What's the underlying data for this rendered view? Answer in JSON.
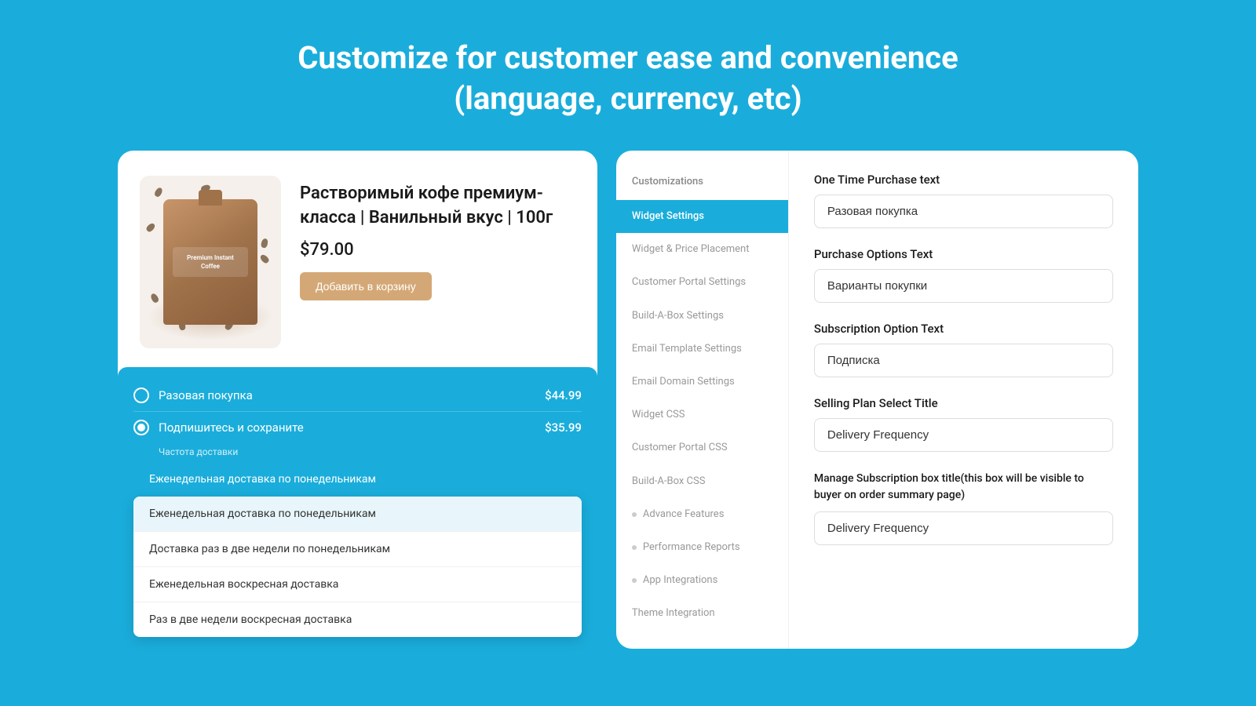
{
  "headline": {
    "line1": "Customize for customer ease and convenience",
    "line2": "(language, currency, etc)"
  },
  "left_card": {
    "product": {
      "title": "Растворимый кофе премиум-класса | Ванильный вкус | 100г",
      "price": "$79.00",
      "add_to_cart": "Добавить в корзину",
      "image_label": "Premium\nInstant\nCoffee"
    },
    "widget": {
      "option_one_time": "Разовая покупка",
      "option_one_time_price": "$44.99",
      "option_subscribe": "Подпишитесь и сохраните",
      "option_subscribe_price": "$35.99",
      "frequency_label": "Частота доставки",
      "dropdown_selected": "Еженедельная доставка по понедельникам",
      "dropdown_items": [
        "Еженедельная доставка по понедельникам",
        "Доставка раз в две недели по понедельникам",
        "Еженедельная воскресная доставка",
        "Раз в две недели воскресная доставка"
      ]
    }
  },
  "right_card": {
    "sidebar_label": "Customizations",
    "sidebar_items": [
      {
        "label": "Widget Settings",
        "active": true
      },
      {
        "label": "Widget & Price Placement",
        "active": false
      },
      {
        "label": "Customer Portal Settings",
        "active": false
      },
      {
        "label": "Build-A-Box Settings",
        "active": false
      },
      {
        "label": "Email Template Settings",
        "active": false
      },
      {
        "label": "Email Domain Settings",
        "active": false
      },
      {
        "label": "Widget CSS",
        "active": false
      },
      {
        "label": "Customer Portal CSS",
        "active": false
      },
      {
        "label": "Build-A-Box CSS",
        "active": false
      },
      {
        "label": "Advance Features",
        "active": false,
        "dot": true
      },
      {
        "label": "Performance Reports",
        "active": false,
        "dot": true
      },
      {
        "label": "App Integrations",
        "active": false,
        "dot": true
      },
      {
        "label": "Theme Integration",
        "active": false
      }
    ],
    "fields": [
      {
        "label": "One Time Purchase text",
        "value": "Разовая покупка",
        "key": "one_time_purchase"
      },
      {
        "label": "Purchase Options Text",
        "value": "Варианты покупки",
        "key": "purchase_options"
      },
      {
        "label": "Subscription Option Text",
        "value": "Подписка",
        "key": "subscription_option"
      },
      {
        "label": "Selling Plan Select Title",
        "value": "Delivery Frequency",
        "key": "selling_plan_title"
      },
      {
        "label": "Manage Subscription box title(this box will be visible to buyer on order summary page)",
        "value": "Delivery Frequency",
        "key": "manage_subscription"
      }
    ]
  }
}
